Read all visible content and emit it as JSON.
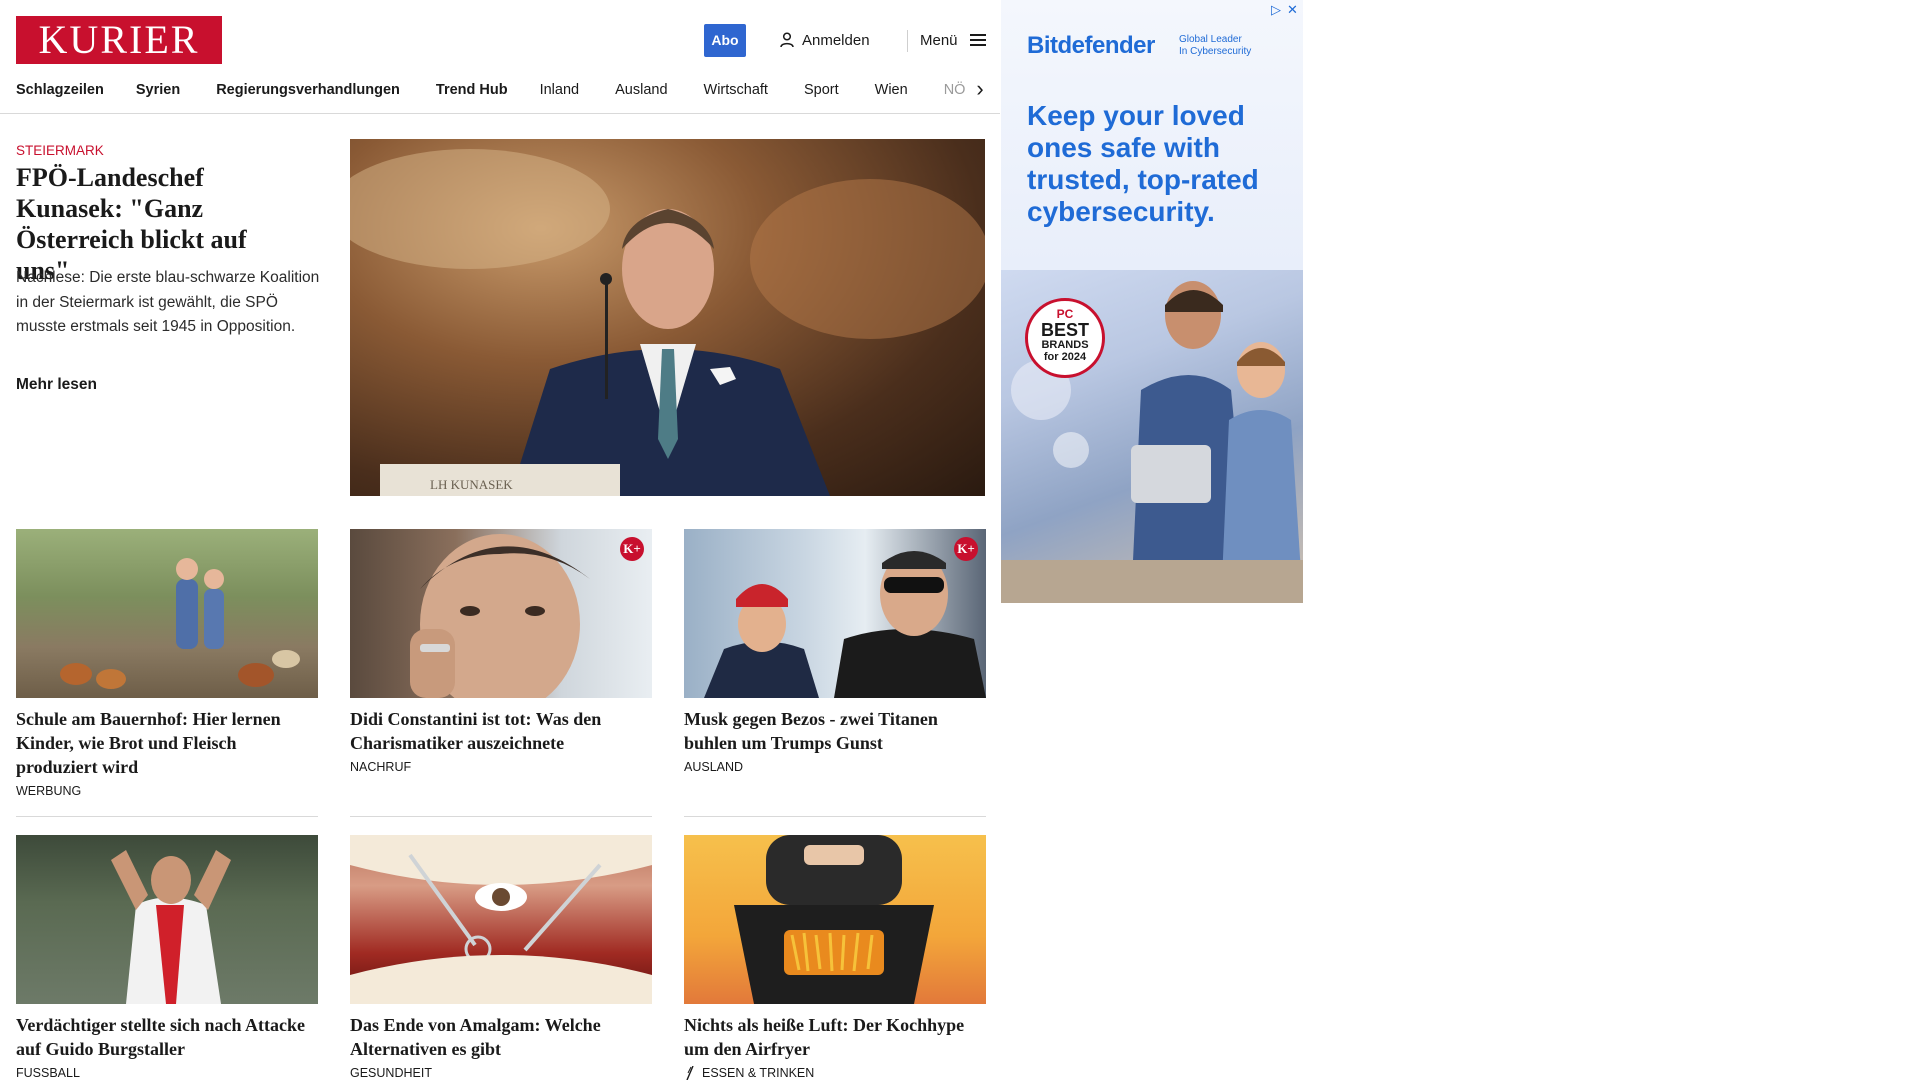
{
  "header": {
    "logo": "KURIER",
    "abo_label": "Abo",
    "login_label": "Anmelden",
    "menu_label": "Menü"
  },
  "nav": {
    "items": [
      "Schlagzeilen",
      "Syrien",
      "Regierungsverhandlungen",
      "Trend Hub",
      "Inland",
      "Ausland",
      "Wirtschaft",
      "Sport",
      "Wien",
      "NÖ"
    ]
  },
  "hero": {
    "kicker": "STEIERMARK",
    "title": "FPÖ-Landeschef Kunasek: \"Ganz Österreich blickt auf uns\"",
    "teaser": "Nachlese: Die erste blau-schwarze Koalition in der Steiermark ist gewählt, die SPÖ musste erstmals seit 1945 in Opposition.",
    "more_label": "Mehr lesen",
    "image_text": "LH KUNASEK"
  },
  "cards": [
    {
      "title": "Schule am Bauernhof: Hier lernen Kinder, wie Brot und Fleisch produziert wird",
      "category": "WERBUNG",
      "plus": false
    },
    {
      "title": "Didi Constantini ist tot: Was den Charismatiker auszeichnete",
      "category": "NACHRUF",
      "plus": true
    },
    {
      "title": "Musk gegen Bezos - zwei Titanen buhlen um Trumps Gunst",
      "category": "AUSLAND",
      "plus": true
    },
    {
      "title": "Verdächtiger stellte sich nach Attacke auf Guido Burgstaller",
      "category": "FUSSBALL",
      "plus": false
    },
    {
      "title": "Das Ende von Amalgam: Welche Alternativen es gibt",
      "category": "GESUNDHEIT",
      "plus": false
    },
    {
      "title": "Nichts als heiße Luft: Der Kochhype um den Airfryer",
      "category": "ESSEN & TRINKEN",
      "plus": false
    }
  ],
  "plus_badge": "K+",
  "ad": {
    "brand": "Bitdefender",
    "tagline_1": "Global Leader",
    "tagline_2": "In Cybersecurity",
    "headline": "Keep your loved ones safe with trusted, top-rated cybersecurity.",
    "badge_pc": "PC",
    "badge_best": "BEST",
    "badge_brands": "BRANDS",
    "badge_year": "for 2024"
  },
  "colors": {
    "brand_red": "#c8102e",
    "abo_blue": "#2f66d0",
    "ad_blue": "#1f6bd6"
  },
  "icons": [
    "user-icon",
    "hamburger-icon",
    "chevron-right-icon",
    "close-icon",
    "adchoices-icon",
    "fork-icon"
  ]
}
